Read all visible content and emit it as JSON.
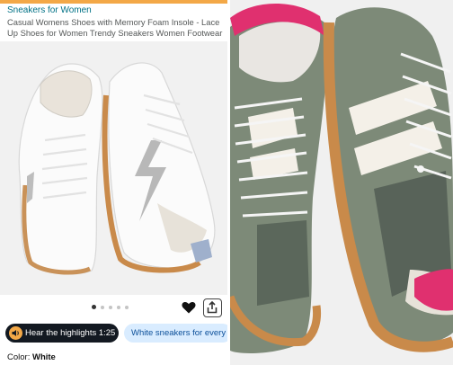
{
  "header": {
    "brand": "Sneakers for Women",
    "title": "Casual Womens Shoes with Memory Foam Insole - Lace Up Shoes for Women Trendy Sneakers Women Footwear"
  },
  "gallery": {
    "dots_count": 5,
    "active_index": 0
  },
  "actions": {
    "highlights_label": "Hear the highlights 1:25",
    "chip_label": "White sneakers for every"
  },
  "color": {
    "label": "Color:",
    "value": "White"
  },
  "colors": {
    "accent_orange": "#f3a847",
    "link_teal": "#007185",
    "chip_bg": "#d9ecff",
    "shoe_green": "#7d8a78",
    "shoe_pink": "#e0306f",
    "sole_gum": "#c98a4a"
  }
}
